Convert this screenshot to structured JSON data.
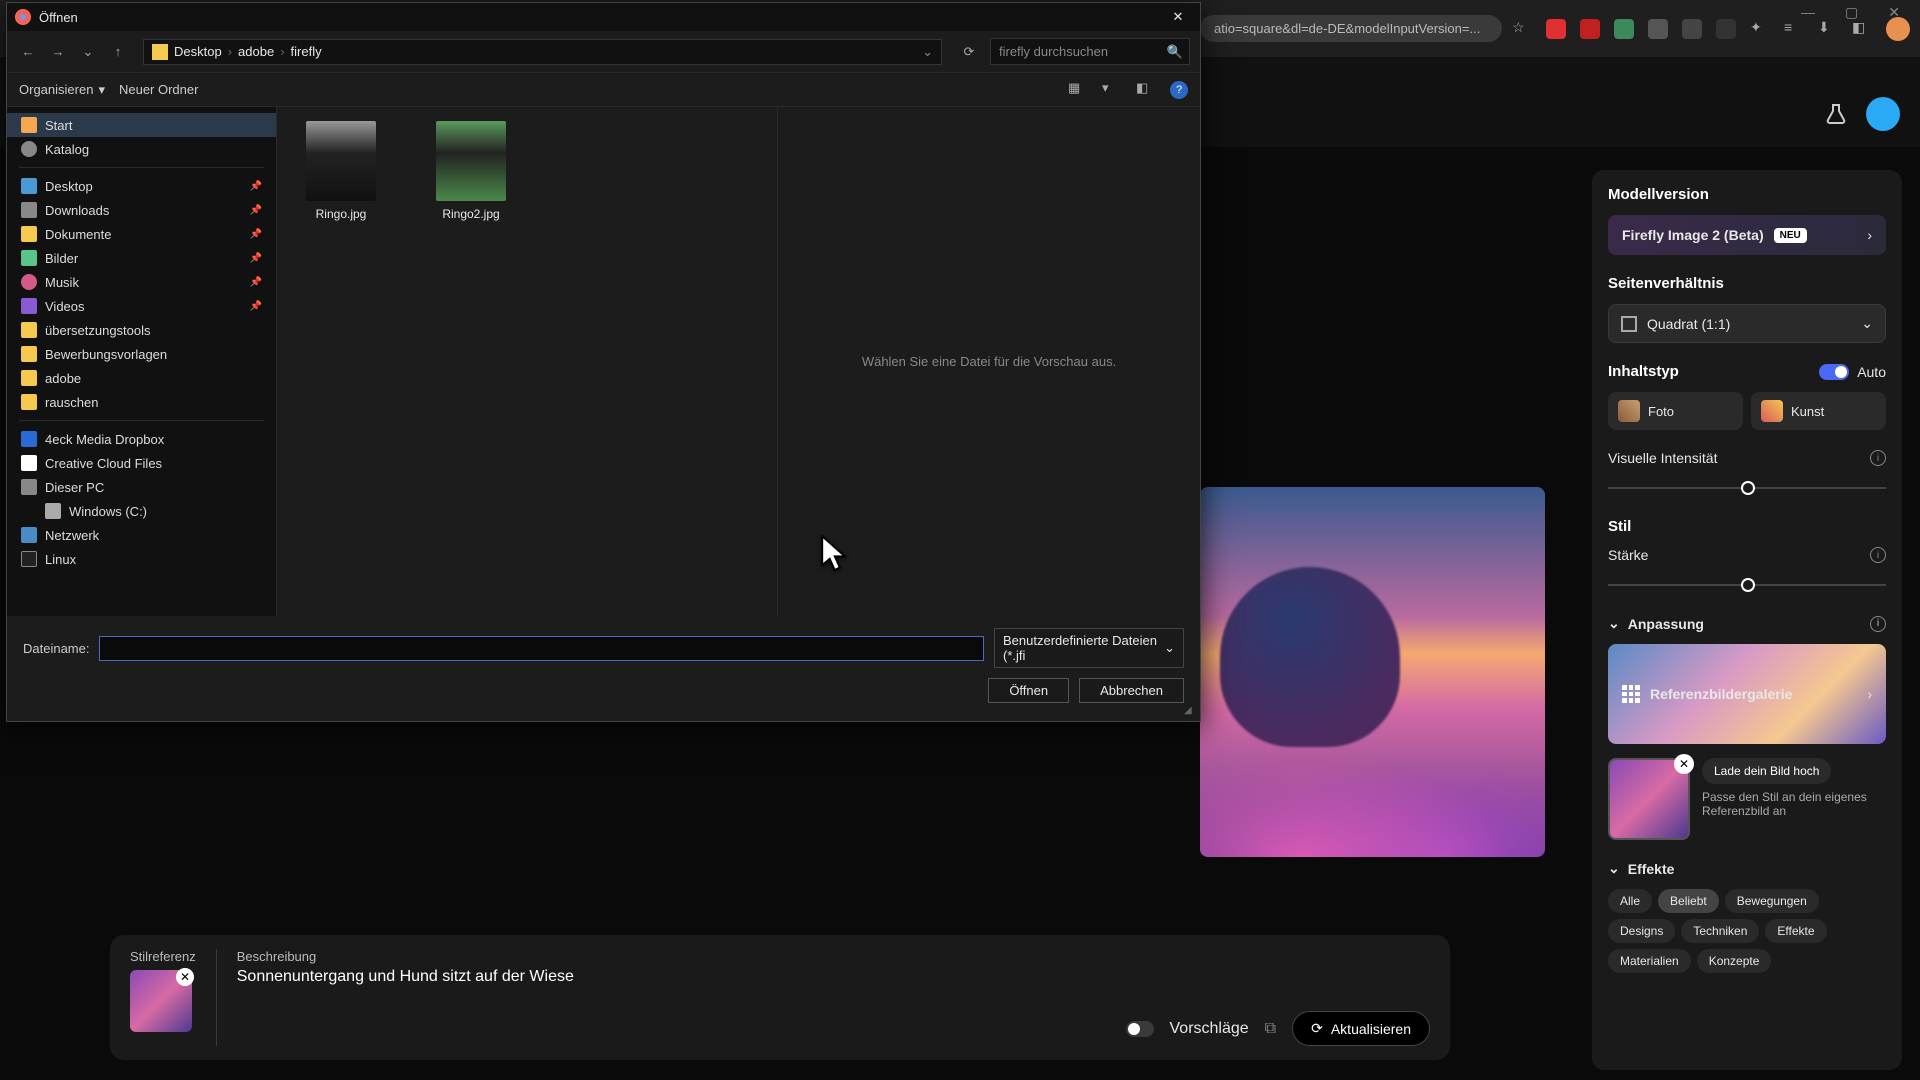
{
  "browser": {
    "url_fragment": "atio=square&dl=de-DE&modelInputVersion=...",
    "window_controls": {
      "min": "—",
      "max": "▢",
      "close": "✕"
    }
  },
  "firefly_top": {},
  "side_panel": {
    "model_section": "Modellversion",
    "model_name": "Firefly Image 2 (Beta)",
    "model_badge": "NEU",
    "aspect_section": "Seitenverhältnis",
    "aspect_value": "Quadrat (1:1)",
    "content_section": "Inhaltstyp",
    "auto_label": "Auto",
    "auto_on": true,
    "chip_foto": "Foto",
    "chip_kunst": "Kunst",
    "intensity_label": "Visuelle Intensität",
    "intensity_pos_pct": 48,
    "stil_section": "Stil",
    "strength_label": "Stärke",
    "strength_pos_pct": 48,
    "anpassung_label": "Anpassung",
    "gallery_label": "Referenzbildergalerie",
    "upload_btn": "Lade dein Bild hoch",
    "upload_hint": "Passe den Stil an dein eigenes Referenzbild an",
    "effekte_label": "Effekte",
    "tags": [
      "Alle",
      "Beliebt",
      "Bewegungen",
      "Designs",
      "Techniken",
      "Effekte",
      "Materialien",
      "Konzepte"
    ],
    "tag_active": "Beliebt"
  },
  "prompt_bar": {
    "stilref_label": "Stilreferenz",
    "desc_label": "Beschreibung",
    "desc_text": "Sonnenuntergang und Hund sitzt auf der Wiese",
    "suggestions_label": "Vorschläge",
    "refresh_label": "Aktualisieren"
  },
  "file_dialog": {
    "title": "Öffnen",
    "breadcrumb": [
      "Desktop",
      "adobe",
      "firefly"
    ],
    "search_placeholder": "firefly durchsuchen",
    "toolbar": {
      "organize": "Organisieren",
      "new_folder": "Neuer Ordner"
    },
    "sidebar": {
      "top": [
        {
          "icon": "home",
          "label": "Start",
          "selected": true
        },
        {
          "icon": "catalog",
          "label": "Katalog"
        }
      ],
      "quick": [
        {
          "icon": "desktop",
          "label": "Desktop",
          "pin": true
        },
        {
          "icon": "downloads",
          "label": "Downloads",
          "pin": true
        },
        {
          "icon": "folder",
          "label": "Dokumente",
          "pin": true
        },
        {
          "icon": "pics",
          "label": "Bilder",
          "pin": true
        },
        {
          "icon": "music",
          "label": "Musik",
          "pin": true
        },
        {
          "icon": "video",
          "label": "Videos",
          "pin": true
        },
        {
          "icon": "folder",
          "label": "übersetzungstools"
        },
        {
          "icon": "folder",
          "label": "Bewerbungsvorlagen"
        },
        {
          "icon": "folder",
          "label": "adobe"
        },
        {
          "icon": "folder",
          "label": "rauschen"
        }
      ],
      "cloud": [
        {
          "icon": "dropbox",
          "label": "4eck Media Dropbox"
        },
        {
          "icon": "cc",
          "label": "Creative Cloud Files"
        },
        {
          "icon": "pc",
          "label": "Dieser PC"
        },
        {
          "icon": "drive",
          "label": "Windows (C:)",
          "indent": true
        },
        {
          "icon": "net",
          "label": "Netzwerk"
        },
        {
          "icon": "linux",
          "label": "Linux"
        }
      ]
    },
    "files": [
      {
        "name": "Ringo.jpg",
        "thumb": "r1"
      },
      {
        "name": "Ringo2.jpg",
        "thumb": "r2"
      }
    ],
    "preview_hint": "Wählen Sie eine Datei für die Vorschau aus.",
    "filename_label": "Dateiname:",
    "filename_value": "",
    "filter_label": "Benutzerdefinierte Dateien (*.jfi",
    "open_btn": "Öffnen",
    "cancel_btn": "Abbrechen"
  }
}
